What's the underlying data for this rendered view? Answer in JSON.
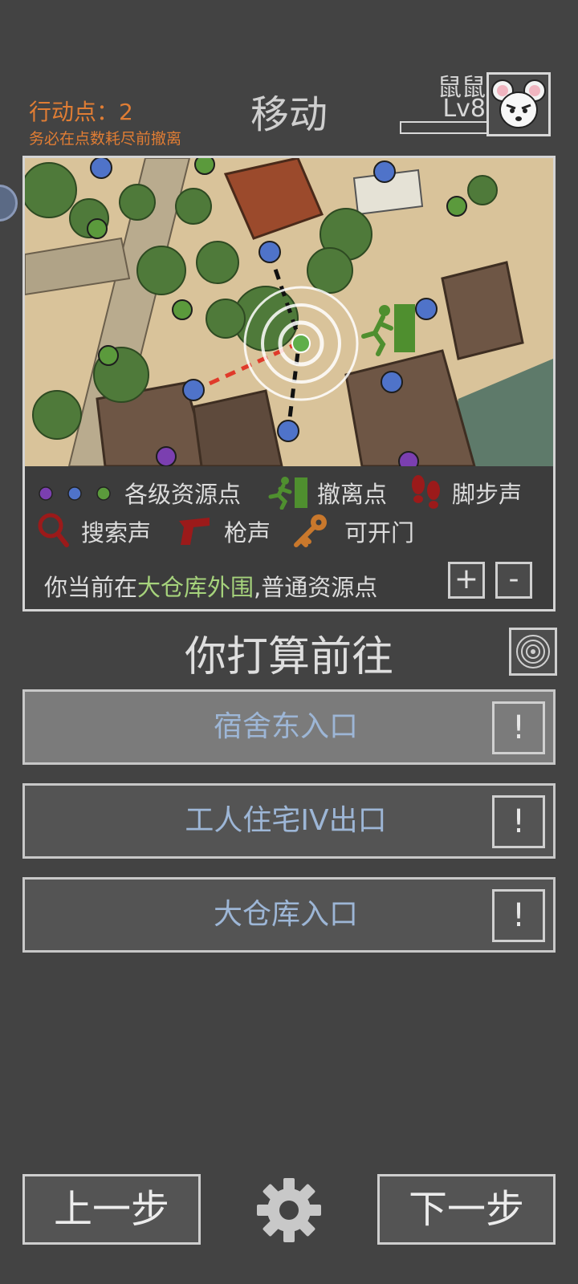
{
  "header": {
    "action_points": "行动点：2",
    "action_hint": "务必在点数耗尽前撤离",
    "title": "移动",
    "player_name": "鼠鼠",
    "player_level": "Lv8"
  },
  "legend": {
    "resource_points": "各级资源点",
    "extraction_point": "撤离点",
    "footsteps": "脚步声",
    "search_sound": "搜索声",
    "gunshot": "枪声",
    "openable_door": "可开门"
  },
  "location": {
    "prefix": "你当前在",
    "place": "大仓库外围",
    "suffix": ",普通资源点"
  },
  "zoom": {
    "plus": "+",
    "minus": "-"
  },
  "prompt": "你打算前往",
  "destinations": [
    {
      "label": "宿舍东入口",
      "info": "!",
      "selected": true
    },
    {
      "label": "工人住宅IV出口",
      "info": "!",
      "selected": false
    },
    {
      "label": "大仓库入口",
      "info": "!",
      "selected": false
    }
  ],
  "nav": {
    "back": "上一步",
    "next": "下一步"
  },
  "colors": {
    "accent_orange": "#e07d34",
    "location_highlight": "#a6d37c",
    "destination_text": "#9db6d6",
    "resource_purple": "#7b3fb0",
    "resource_blue": "#4f73c9",
    "resource_green": "#5b9a3c",
    "extraction_green": "#4f8f2f",
    "danger_red": "#9b1a1a",
    "key_orange": "#c9782c"
  },
  "icons": [
    "avatar-mouse-icon",
    "extraction-runner-icon",
    "footsteps-icon",
    "magnifier-icon",
    "pistol-icon",
    "key-icon",
    "radar-icon",
    "gear-icon",
    "info-icon"
  ]
}
